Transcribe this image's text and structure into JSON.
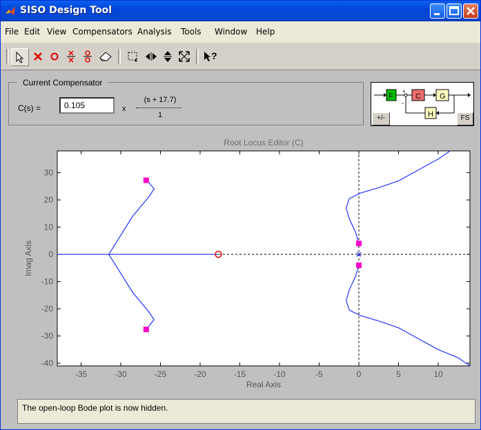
{
  "window": {
    "title": "SISO Design Tool"
  },
  "menu": [
    {
      "label": "File"
    },
    {
      "label": "Edit"
    },
    {
      "label": "View"
    },
    {
      "label": "Compensators"
    },
    {
      "label": "Analysis"
    },
    {
      "label": "Tools"
    },
    {
      "label": "Window"
    },
    {
      "label": "Help"
    }
  ],
  "compensator": {
    "legend": "Current Compensator",
    "label": "C(s) =",
    "gain": "0.105",
    "times": "x",
    "numerator": "(s + 17.7)",
    "denominator": "1"
  },
  "diagram": {
    "f": "F",
    "c": "C",
    "g": "G",
    "h": "H",
    "plus_minus": "+/-",
    "fs": "FS",
    "sum_plus": "+",
    "sum_minus": "-"
  },
  "editor": {
    "title": "Root Locus Editor (C)"
  },
  "chart_data": {
    "type": "root-locus",
    "xlabel": "Real Axis",
    "ylabel": "Imag Axis",
    "xlim": [
      -38,
      14
    ],
    "ylim": [
      -41,
      38
    ],
    "xticks": [
      -35,
      -30,
      -25,
      -20,
      -15,
      -10,
      -5,
      0,
      5,
      10
    ],
    "yticks": [
      30,
      20,
      10,
      0,
      -10,
      -20,
      -30,
      -40
    ],
    "xtick_labels": [
      "-35",
      "-30",
      "-25",
      "-20",
      "-15",
      "-10",
      "-5",
      "0",
      "5",
      "10"
    ],
    "ytick_labels": [
      "30",
      "20",
      "10",
      "0",
      "-10",
      "-20",
      "-30",
      "-40"
    ],
    "zeros": [
      [
        -17.7,
        0
      ]
    ],
    "poles": [
      [
        0,
        0
      ]
    ],
    "closed_loop_poles": [
      [
        -26.8,
        27.2
      ],
      [
        -26.8,
        -27.6
      ],
      [
        0,
        4
      ],
      [
        0,
        -4
      ]
    ],
    "branches": [
      [
        [
          -26.8,
          27.2
        ],
        [
          -26.5,
          26.5
        ],
        [
          -25.8,
          24
        ],
        [
          -26.5,
          21
        ],
        [
          -28.5,
          14
        ],
        [
          -31.5,
          0
        ]
      ],
      [
        [
          -26.8,
          -27.6
        ],
        [
          -26.5,
          -26.5
        ],
        [
          -25.8,
          -24
        ],
        [
          -26.5,
          -21
        ],
        [
          -28.5,
          -14
        ],
        [
          -31.5,
          0
        ]
      ],
      [
        [
          -38,
          0
        ],
        [
          -17.7,
          0
        ]
      ],
      [
        [
          0,
          4
        ],
        [
          -0.4,
          8
        ],
        [
          -1.2,
          13
        ],
        [
          -1.6,
          17
        ],
        [
          -1.2,
          20.5
        ],
        [
          0.2,
          22.5
        ],
        [
          2.5,
          24.5
        ],
        [
          5,
          27
        ],
        [
          7.5,
          31
        ],
        [
          10,
          35
        ],
        [
          11.5,
          38
        ]
      ],
      [
        [
          0,
          -4
        ],
        [
          -0.4,
          -8
        ],
        [
          -1.2,
          -13
        ],
        [
          -1.6,
          -17
        ],
        [
          -1.2,
          -20.5
        ],
        [
          0.2,
          -22.5
        ],
        [
          2.5,
          -24.5
        ],
        [
          5,
          -27
        ],
        [
          7.5,
          -31
        ],
        [
          10,
          -35
        ],
        [
          12.5,
          -38
        ],
        [
          14,
          -41
        ]
      ]
    ],
    "grid": false
  },
  "status": {
    "text": "The open-loop Bode plot is now hidden."
  },
  "colors": {
    "locus": "#2233ff",
    "pole_marker": "#ff00cc",
    "zero": "#ff0000",
    "title_bar": "#0346d9"
  }
}
